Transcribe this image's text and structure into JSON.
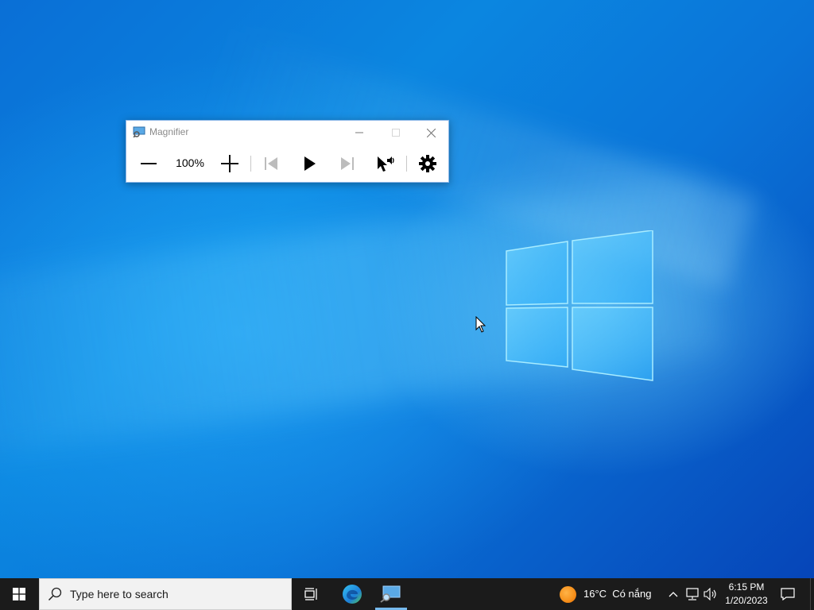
{
  "magnifier": {
    "title": "Magnifier",
    "zoom_level": "100%",
    "tools": {
      "zoom_out": "minus-icon",
      "zoom_in": "plus-icon",
      "previous": "skip-back-icon",
      "play": "play-icon",
      "next": "skip-forward-icon",
      "read_from_here": "pointer-speaker-icon",
      "settings": "gear-icon"
    }
  },
  "taskbar": {
    "search_placeholder": "Type here to search",
    "weather": {
      "temperature": "16°C",
      "condition": "Có nắng"
    },
    "clock": {
      "time": "6:15 PM",
      "date": "1/20/2023"
    }
  },
  "colors": {
    "desktop_accent": "#0a74d8",
    "taskbar_bg": "#1b1b1b",
    "active_underline": "#76b9ed"
  }
}
